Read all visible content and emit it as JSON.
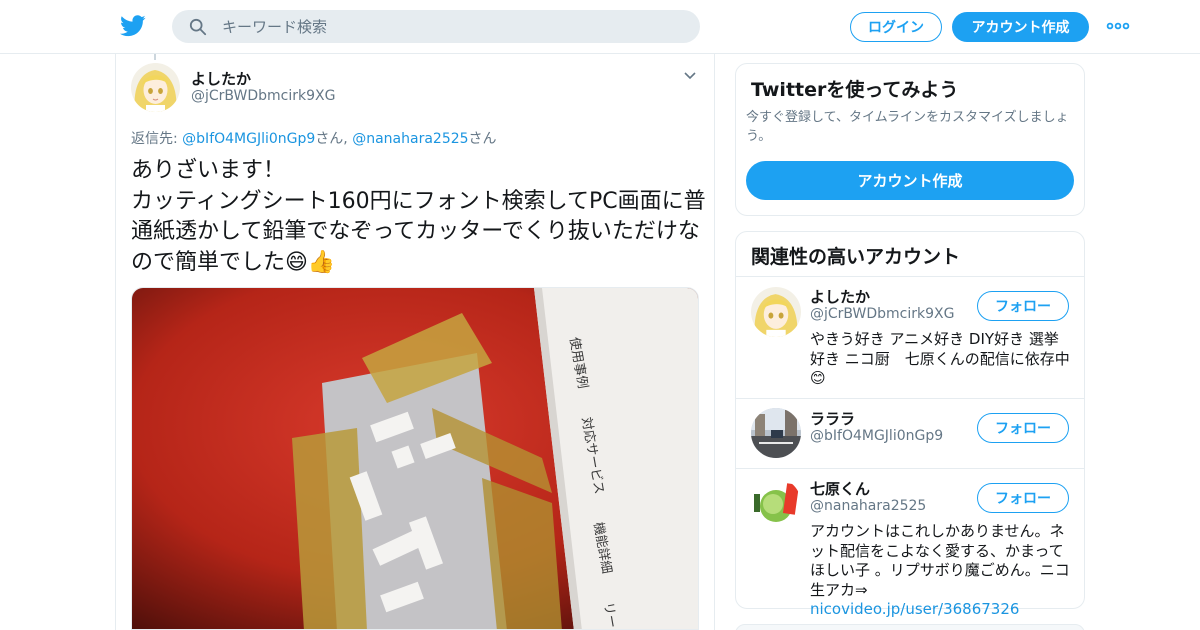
{
  "header": {
    "search_placeholder": "キーワード検索",
    "login_label": "ログイン",
    "signup_label": "アカウント作成",
    "colors": {
      "accent": "#1da1f2",
      "text": "#14171a",
      "muted": "#657786",
      "border": "#e6ecf0"
    }
  },
  "tweet": {
    "display_name": "よしたか",
    "handle": "@jCrBWDbmcirk9XG",
    "reply_prefix": "返信先:",
    "reply_user1": "@bIfO4MGJli0nGp9",
    "reply_suffix1": "さん,",
    "reply_user2": "@nanahara2525",
    "reply_suffix2": "さん",
    "text": "ありざいます！\nカッティングシート160円にフォント検索してPC画面に普通紙透かして鉛筆でなぞってカッターでくり抜いただけなので簡単でした😄👍",
    "photo": {
      "card_line1": "使用事例",
      "card_line2": "対応サービス",
      "card_line3": "機能詳細",
      "card_line4": "リー"
    }
  },
  "sidebar": {
    "signup_card": {
      "title": "Twitterを使ってみよう",
      "subtitle": "今すぐ登録して、タイムラインをカスタマイズしましょう。",
      "button": "アカウント作成"
    },
    "related": {
      "title": "関連性の高いアカウント",
      "follow_label": "フォロー",
      "accounts": [
        {
          "name": "よしたか",
          "handle": "@jCrBWDbmcirk9XG",
          "bio": "やきう好き アニメ好き DIY好き 選挙好き ニコ厨　七原くんの配信に依存中😊"
        },
        {
          "name": "ラララ",
          "handle": "@bIfO4MGJli0nGp9",
          "bio": ""
        },
        {
          "name": "七原くん",
          "handle": "@nanahara2525",
          "bio": "アカウントはこれしかありません。ネット配信をこよなく愛する、かまってほしい子 。リプサボり魔ごめん。ニコ生アカ⇒ ",
          "bio_link": "nicovideo.jp/user/36867326"
        }
      ]
    }
  }
}
